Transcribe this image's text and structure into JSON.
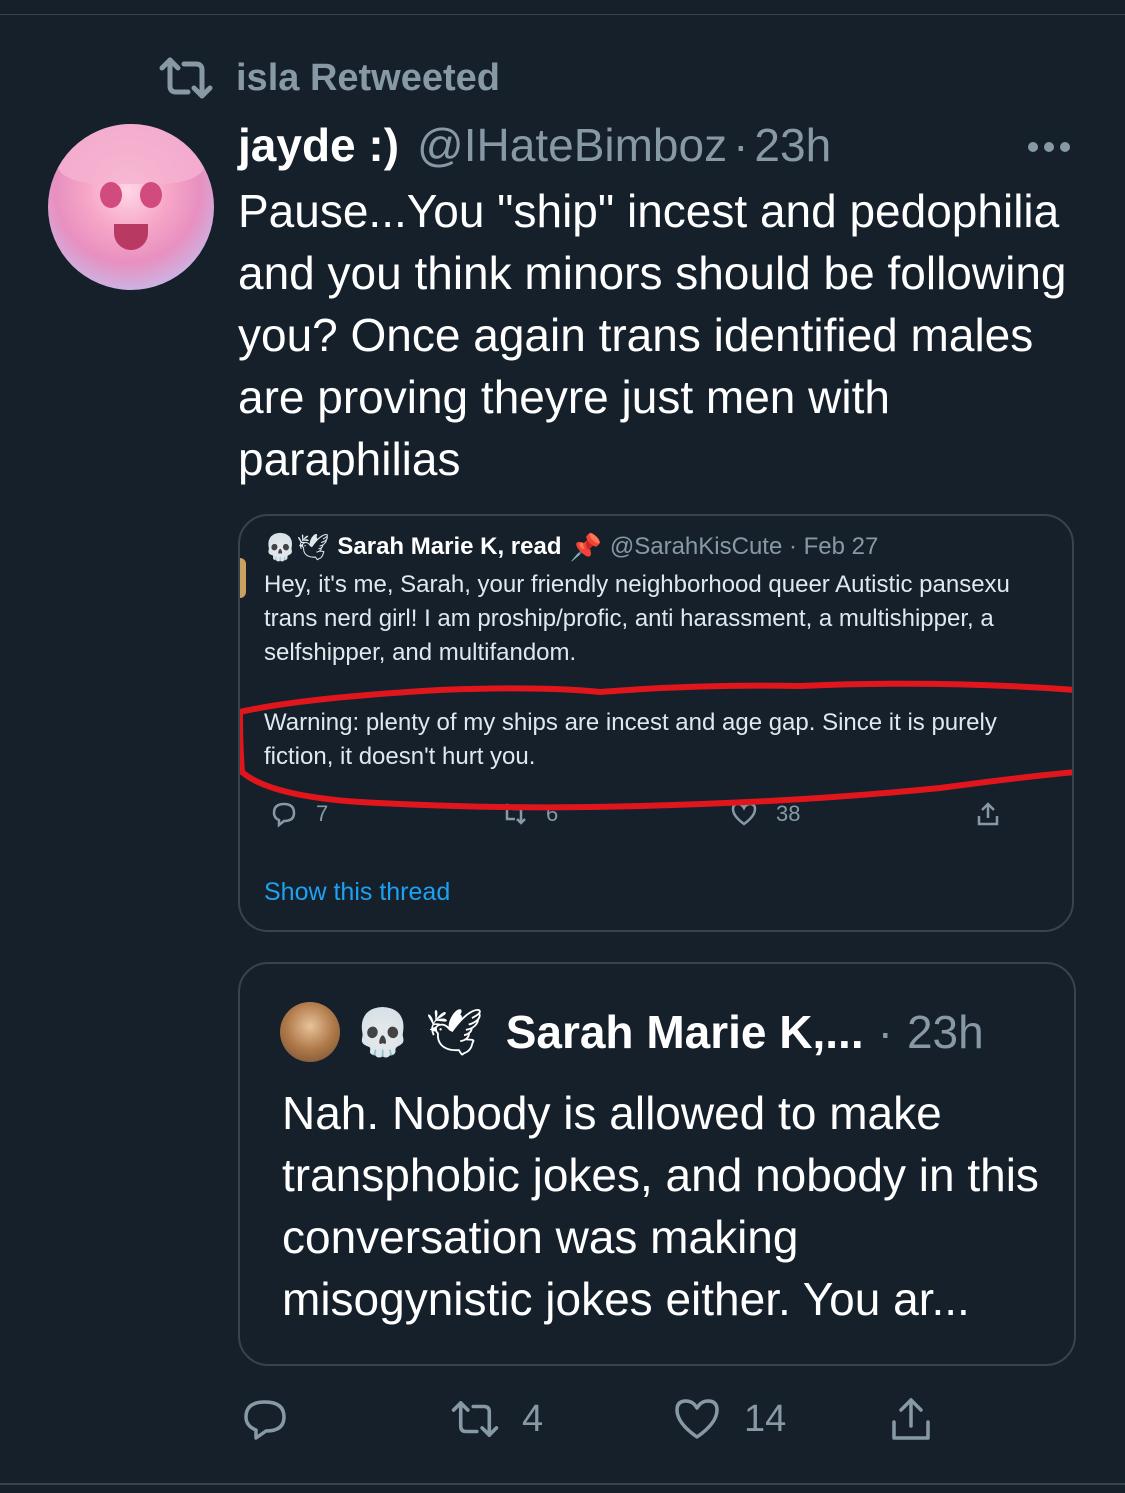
{
  "retweet_context": {
    "text": "isla Retweeted"
  },
  "tweet": {
    "display_name": "jayde :)",
    "handle": "@IHateBimboz",
    "separator": "·",
    "time": "23h",
    "text": "Pause...You \"ship\" incest and pedophilia and you think minors should be following you? Once again trans identified males are proving theyre just men with paraphilias"
  },
  "embedded_screenshot": {
    "emojis": "💀🕊",
    "display_name": "Sarah Marie K, read",
    "pin_emoji": "📌",
    "handle": "@SarahKisCute · Feb 27",
    "bio_lines": [
      "Hey, it's me, Sarah, your friendly neighborhood queer Autistic pansexu",
      "trans nerd girl! I am proship/profic, anti harassment, a multishipper, a",
      "selfshipper, and multifandom."
    ],
    "warning_lines": [
      "Warning: plenty of my ships are incest and age gap. Since it is purely",
      "fiction, it doesn't hurt you."
    ],
    "reply_count": "7",
    "retweet_count": "6",
    "like_count": "38",
    "show_thread": "Show this thread",
    "annotation_color": "#e0161c"
  },
  "quoted_tweet": {
    "emoji_skull": "💀",
    "emoji_dove": "🕊",
    "display_name": "Sarah Marie K,...",
    "separator": "·",
    "time": "23h",
    "text": "Nah. Nobody is allowed to make transphobic jokes, and nobody in this conversation was making misogynistic jokes either. You ar..."
  },
  "actions": {
    "reply_icon": "reply-icon",
    "retweet_count": "4",
    "like_count": "14",
    "share_icon": "share-icon"
  },
  "colors": {
    "background": "#15202b",
    "muted": "#8899a6",
    "border": "#38444d",
    "link": "#1da1f2"
  }
}
